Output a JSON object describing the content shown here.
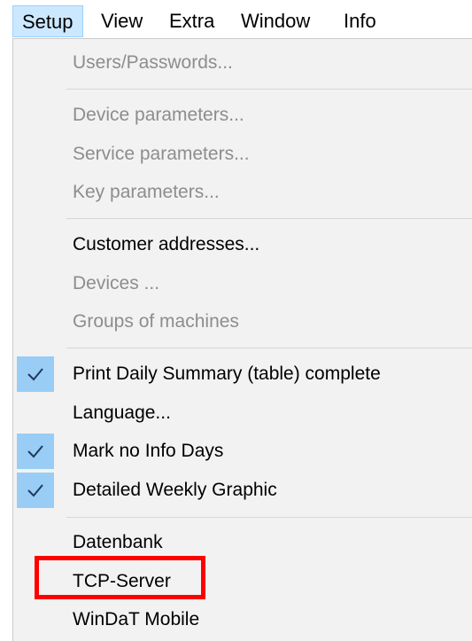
{
  "menubar": {
    "items": [
      {
        "label": "Setup"
      },
      {
        "label": "View"
      },
      {
        "label": "Extra"
      },
      {
        "label": "Window"
      },
      {
        "label": "Info"
      }
    ]
  },
  "menu": {
    "items": [
      {
        "label": "Users/Passwords...",
        "enabled": false,
        "checked": false
      },
      {
        "label": "Device parameters...",
        "enabled": false,
        "checked": false
      },
      {
        "label": "Service parameters...",
        "enabled": false,
        "checked": false
      },
      {
        "label": "Key parameters...",
        "enabled": false,
        "checked": false
      },
      {
        "label": "Customer addresses...",
        "enabled": true,
        "checked": false
      },
      {
        "label": "Devices ...",
        "enabled": false,
        "checked": false
      },
      {
        "label": "Groups of machines",
        "enabled": false,
        "checked": false
      },
      {
        "label": "Print Daily Summary (table) complete",
        "enabled": true,
        "checked": true
      },
      {
        "label": "Language...",
        "enabled": true,
        "checked": false
      },
      {
        "label": "Mark no Info Days",
        "enabled": true,
        "checked": true
      },
      {
        "label": "Detailed Weekly Graphic",
        "enabled": true,
        "checked": true
      },
      {
        "label": "Datenbank",
        "enabled": true,
        "checked": false
      },
      {
        "label": "TCP-Server",
        "enabled": true,
        "checked": false,
        "highlighted": true
      },
      {
        "label": "WinDaT Mobile",
        "enabled": true,
        "checked": false
      }
    ]
  },
  "colors": {
    "active_menu_bg": "#cce8ff",
    "check_bg": "#99cdf5",
    "disabled_text": "#8d8d8d",
    "highlight_border": "#ff0000"
  }
}
